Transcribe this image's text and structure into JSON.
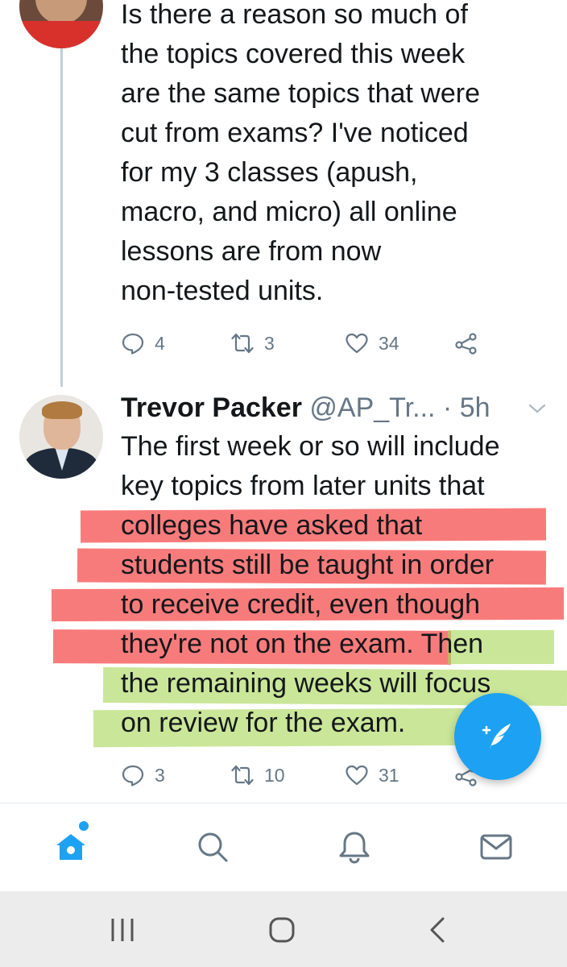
{
  "previous_tweet": {
    "text_lines": [
      "Is there a reason so much of",
      "the topics covered this week",
      "are the same topics that were",
      "cut from exams? I've noticed",
      "for my 3 classes (apush,",
      "macro, and micro) all online",
      "lessons are from now",
      "non-tested units."
    ],
    "replies": "4",
    "retweets": "3",
    "likes": "34"
  },
  "reply_tweet": {
    "author_name": "Trevor Packer",
    "handle": "@AP_Tr...",
    "time": "· 5h",
    "text_lines": [
      "The first week or so will include",
      "key topics from later units that",
      "colleges have asked that",
      "students still be taught in order",
      "to receive credit, even though",
      "they're not on the exam.",
      "Then",
      "the remaining weeks will focus",
      "on review for the exam."
    ],
    "replies": "3",
    "retweets": "10",
    "likes": "31"
  },
  "icons": {
    "reply": "reply-icon",
    "retweet": "retweet-icon",
    "like": "heart-icon",
    "share": "share-icon",
    "compose": "compose-tweet-icon",
    "home": "home-icon",
    "search": "search-icon",
    "notifications": "bell-icon",
    "messages": "mail-icon"
  },
  "colors": {
    "accent": "#1da1f2",
    "highlight_red": "#f54848",
    "highlight_green": "#aad75a",
    "muted_text": "#657786"
  }
}
